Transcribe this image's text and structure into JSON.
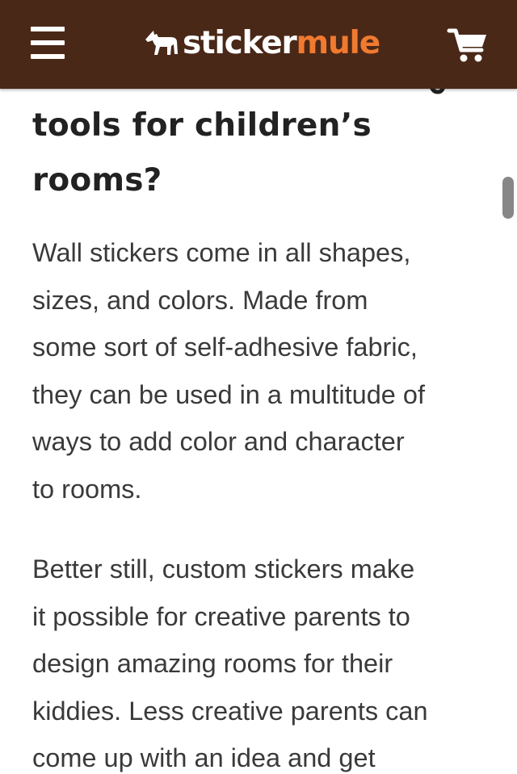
{
  "header": {
    "logo_text_white": "sticker",
    "logo_text_orange": "mule",
    "menu_icon": "hamburger-menu-icon",
    "cart_icon": "shopping-cart-icon",
    "logo_icon": "mule-logo-icon",
    "colors": {
      "background": "#4a2818",
      "logo_accent": "#f07a2f",
      "icon": "#ffffff"
    }
  },
  "article": {
    "heading_lines": [
      "tools for children’s",
      "rooms?"
    ],
    "paragraph1_lines": [
      "Wall stickers come in all shapes,",
      "sizes, and colors. Made from",
      "some sort of self-adhesive fabric,",
      "they can be used in a multitude of",
      "ways to add color and character",
      "to rooms."
    ],
    "paragraph2_lines": [
      "Better still, custom stickers make",
      "it possible for creative parents to",
      "design amazing rooms for their",
      "kiddies. Less creative parents can",
      "come up with an idea and get"
    ]
  }
}
